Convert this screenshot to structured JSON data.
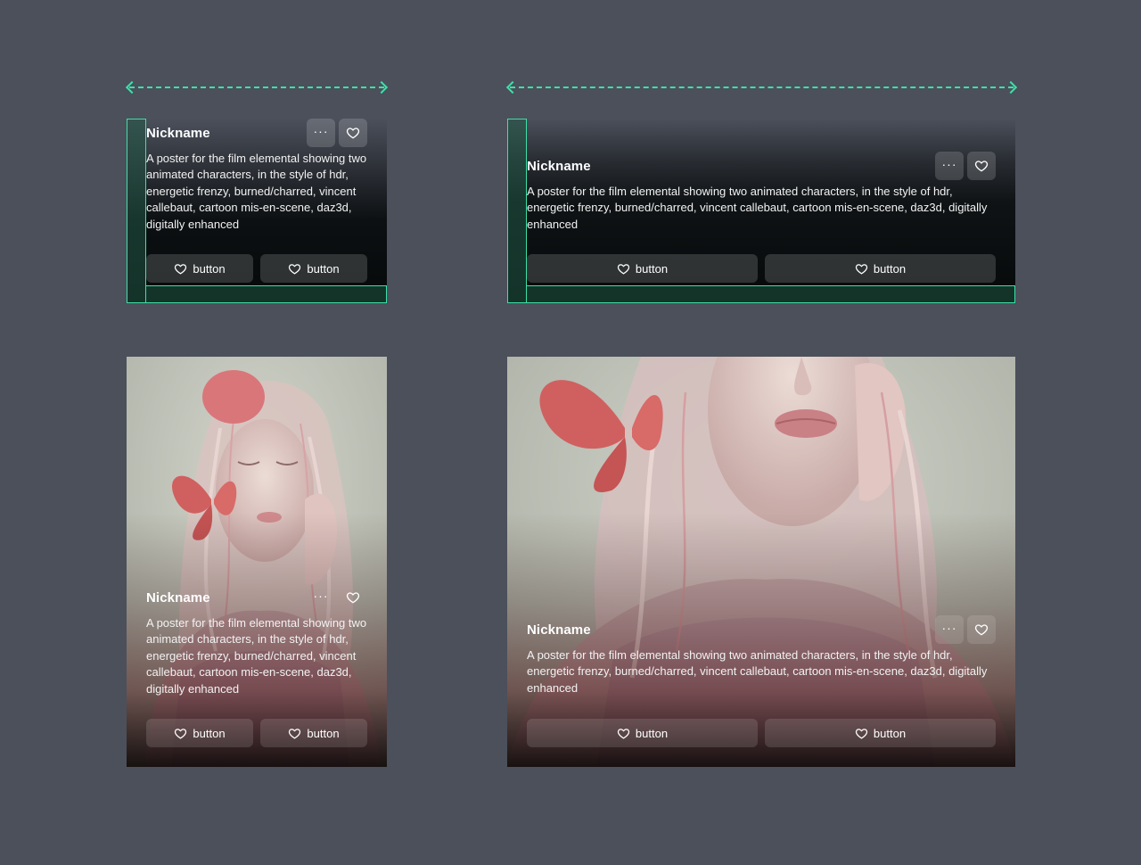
{
  "colors": {
    "canvas": "#4b505b",
    "spec_accent": "#3ee0a7",
    "card_dark": "#05090a",
    "button_bg": "rgba(255,255,255,0.16)"
  },
  "cards": [
    {
      "nickname": "Nickname",
      "description": "A poster for the film elemental showing two animated characters, in the style of hdr, energetic frenzy, burned/charred, vincent callebaut, cartoon mis-en-scene, daz3d, digitally enhanced",
      "more_icon": "more-horizontal-icon",
      "like_icon": "heart-icon",
      "buttons": [
        {
          "label": "button",
          "icon": "heart-icon"
        },
        {
          "label": "button",
          "icon": "heart-icon"
        }
      ]
    },
    {
      "nickname": "Nickname",
      "description": "A poster for the film elemental showing two animated characters, in the style of hdr, energetic frenzy, burned/charred, vincent callebaut, cartoon mis-en-scene, daz3d, digitally enhanced",
      "more_icon": "more-horizontal-icon",
      "like_icon": "heart-icon",
      "buttons": [
        {
          "label": "button",
          "icon": "heart-icon"
        },
        {
          "label": "button",
          "icon": "heart-icon"
        }
      ]
    },
    {
      "nickname": "Nickname",
      "description": "A poster for the film elemental showing two animated characters, in the style of hdr, energetic frenzy, burned/charred, vincent callebaut, cartoon mis-en-scene, daz3d, digitally enhanced",
      "more_icon": "more-horizontal-icon",
      "like_icon": "heart-icon",
      "buttons": [
        {
          "label": "button",
          "icon": "heart-icon"
        },
        {
          "label": "button",
          "icon": "heart-icon"
        }
      ]
    },
    {
      "nickname": "Nickname",
      "description": "A poster for the film elemental showing two animated characters, in the style of hdr, energetic frenzy, burned/charred, vincent callebaut, cartoon mis-en-scene, daz3d, digitally enhanced",
      "more_icon": "more-horizontal-icon",
      "like_icon": "heart-icon",
      "buttons": [
        {
          "label": "button",
          "icon": "heart-icon"
        },
        {
          "label": "button",
          "icon": "heart-icon"
        }
      ]
    }
  ]
}
